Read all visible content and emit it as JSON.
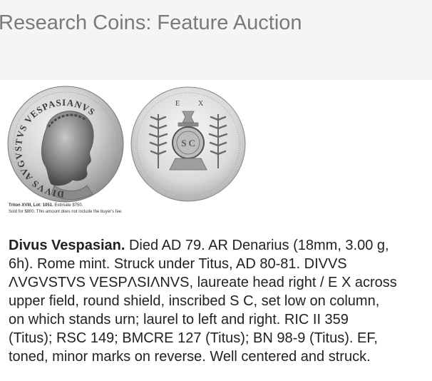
{
  "header": {
    "title": "Research Coins: Feature Auction"
  },
  "coin_image": {
    "obverse_legend": "DIVVS AVGVSTVS VESPASIANVS",
    "reverse_letters": "S C",
    "reverse_field_left": "E",
    "reverse_field_right": "X"
  },
  "caption": {
    "sale_label": "Triton XVIII, Lot: 1051.",
    "estimate": "Estimate $750.",
    "sold_text": "Sold for $800. This amount does not include the buyer's fee."
  },
  "lot": {
    "name": "Divus Vespasian.",
    "lines": [
      " Died AD 79. AR Denarius (18mm, 3.00 g,",
      "6h). Rome mint. Struck under Titus, AD 80-81. DIVVS",
      "ΛVGVSTVS VESPΛSIΛNVS, laureate head right / E X across",
      "upper field, round shield, inscribed S C, set low on column,",
      "on which stands urn; laurel to left and right. RIC II 359",
      "(Titus); RSC 149; BMCRE 127 (Titus); BN 98-9 (Titus). EF,",
      "toned, minor marks on reverse. Well centered and struck."
    ]
  }
}
